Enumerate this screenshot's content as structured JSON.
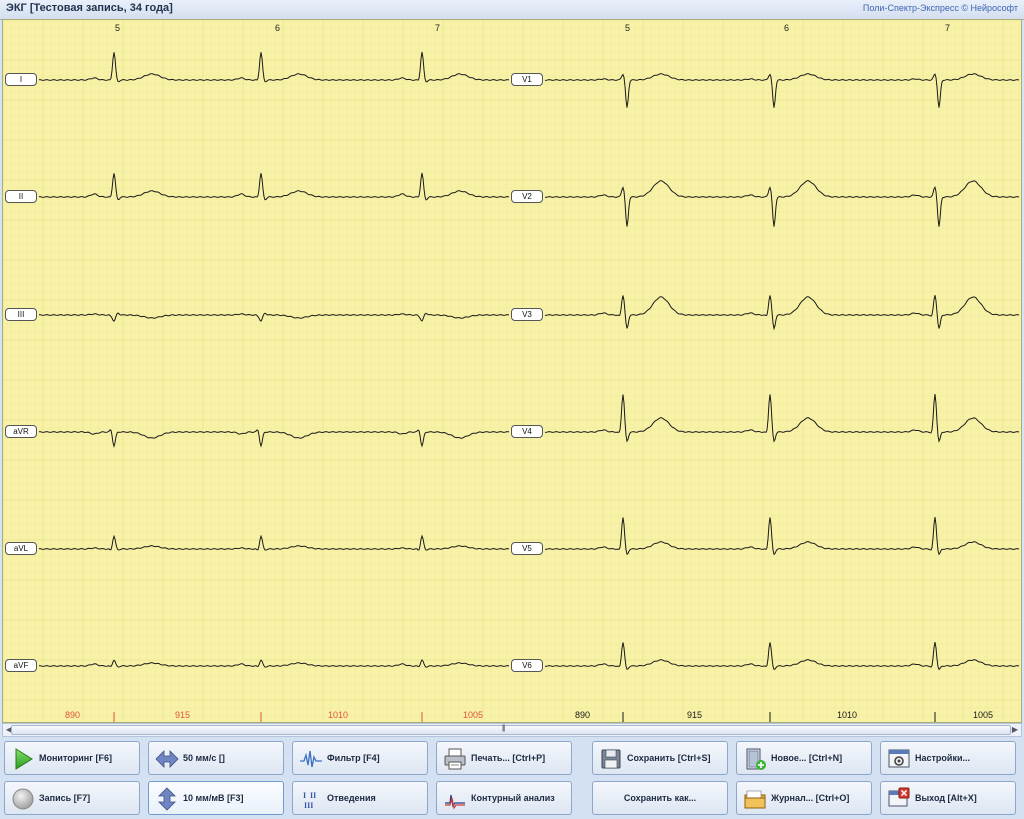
{
  "window": {
    "title": "ЭКГ [Тестовая запись, 34 года]",
    "brand": "Поли-Спектр-Экспресс © Нейрософт"
  },
  "ecg": {
    "left_leads": [
      "I",
      "II",
      "III",
      "aVR",
      "aVL",
      "aVF"
    ],
    "right_leads": [
      "V1",
      "V2",
      "V3",
      "V4",
      "V5",
      "V6"
    ],
    "beat_numbers_left": [
      "5",
      "6",
      "7"
    ],
    "beat_numbers_right": [
      "5",
      "6",
      "7"
    ],
    "rr_left": [
      "890",
      "915",
      "1010",
      "1005"
    ],
    "rr_right": [
      "890",
      "915",
      "1010",
      "1005"
    ],
    "colors": {
      "paper": "#f7f2a6",
      "trace": "#1a1a1a",
      "rr_left": "#e0563a",
      "rr_right": "#1a1a1a",
      "marker": "#e0563a"
    }
  },
  "scrollbar": {
    "grip": "|||"
  },
  "toolbar": {
    "row1": [
      {
        "label": "Мониторинг [F6]",
        "icon": "play-icon"
      },
      {
        "label": "50 мм/с []",
        "icon": "horizontal-arrows-icon"
      },
      {
        "label": "Фильтр [F4]",
        "icon": "waveform-icon"
      },
      {
        "label": "Печать... [Ctrl+P]",
        "icon": "printer-icon"
      },
      {
        "label": "Сохранить [Ctrl+S]",
        "icon": "floppy-icon"
      },
      {
        "label": "Новое... [Ctrl+N]",
        "icon": "new-door-icon"
      },
      {
        "label": "Настройки...",
        "icon": "settings-window-icon"
      }
    ],
    "row2": [
      {
        "label": "Запись [F7]",
        "icon": "record-circle-icon"
      },
      {
        "label": "10 мм/мВ [F3]",
        "icon": "vertical-arrows-icon"
      },
      {
        "label": "Отведения",
        "icon": "leads-roman-icon"
      },
      {
        "label": "Контурный анализ",
        "icon": "contour-analysis-icon"
      },
      {
        "label": "Сохранить как...",
        "icon": ""
      },
      {
        "label": "Журнал... [Ctrl+O]",
        "icon": "journal-folder-icon"
      },
      {
        "label": "Выход [Alt+X]",
        "icon": "exit-window-icon"
      }
    ],
    "leads_icon_text": [
      "I",
      "II",
      "III"
    ]
  }
}
